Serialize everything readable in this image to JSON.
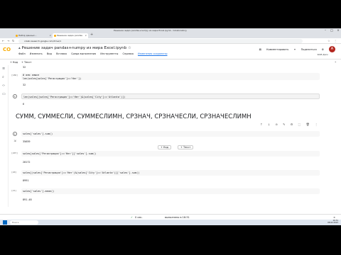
{
  "browser": {
    "window_title": "Решение задач pandas+numpy из мира Excel.ipynb - Colaboratory",
    "tabs": [
      {
        "label": "Набор данных..."
      },
      {
        "label": "Решение задач pandas"
      }
    ],
    "new_tab": "+",
    "url": "colab.research.google.com/drive/1"
  },
  "colab": {
    "logo": "CO",
    "notebook_title": "Решение задач pandas+numpy из мира Excel.ipynb",
    "drive_icon": "drive-icon",
    "menu": [
      "Файл",
      "Изменить",
      "Вид",
      "Вставка",
      "Среда выполнения",
      "Инструменты",
      "Справка"
    ],
    "changes": "Изменения сохранены",
    "comment_btn": "Комментировать",
    "share_btn": "Поделиться",
    "avatar": "A",
    "ram": "RAM",
    "disk": "Диск",
    "toolbar_code": "+ Код",
    "toolbar_text": "+ Текст",
    "colors": {
      "accent": "#f9ab00",
      "link": "#1a73e8",
      "avatar": "#b3261e"
    }
  },
  "cells": {
    "out1": "32",
    "c2_prompt": "[186]",
    "c2_comment": "# или смысл",
    "c2_code": "len(sales[sales['Регистрация']=='Нет'])",
    "out2": "32",
    "c3_code": "len(sales[(sales['Регистрация']=='Нет')&(sales['City']=='Atlanta')])",
    "out3": "6",
    "heading": "СУММ, СУММЕСЛИ, СУММЕСЛИМН, СРЗНАЧ, СРЗНАЧЕСЛИ, СРЗНАЧЕСЛИМН",
    "c4_code": "sales['sales'].sum()",
    "out4": "35659",
    "add_code": "+ Код",
    "add_text": "+ Текст",
    "c5_prompt": "[207]",
    "c5_code": "sales[sales['Регистрация']=='Нет']['sales'].sum()",
    "out5": "28172",
    "c6_prompt": "[20]",
    "c6_code": "sales[(sales['Регистрация']=='Нет')&(sales['City']=='Atlanta')]['sales'].sum()",
    "out6": "8991",
    "c7_prompt": "[21]",
    "c7_code": "sales['sales'].mean()",
    "out7": "891.48"
  },
  "status": {
    "check": "✓",
    "time": "0 сек.",
    "done": "выполнено в 16:31"
  },
  "taskbar": {
    "search": "Поиск",
    "time": "16:31",
    "date": "08.02.2023"
  }
}
